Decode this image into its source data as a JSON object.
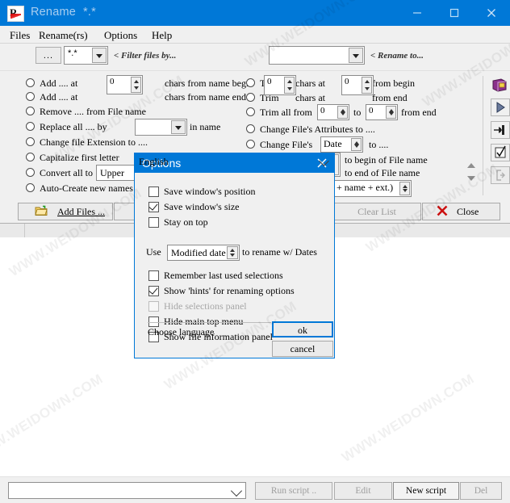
{
  "window": {
    "title": "Rename",
    "title_pattern": "*.*",
    "controls": {
      "minimize": "minimize-icon",
      "maximize": "maximize-icon",
      "close": "close-icon"
    },
    "accent_color": "#0078d7",
    "titlebar_text_color": "#a9cef0",
    "background": "#f0f0f0"
  },
  "menu": {
    "items": [
      "Files",
      "Rename(rs)",
      "Options",
      "Help"
    ]
  },
  "toolbar": {
    "browse_label": "...",
    "filter_value": "*.*",
    "filter_hint": "< Filter files by...",
    "renameto_value": "",
    "renameto_hint": "< Rename to..."
  },
  "left_options": [
    {
      "label": "Add ....  at",
      "spin": "0",
      "suffix": "chars from name begin"
    },
    {
      "label": "Add ....  at",
      "spin": "",
      "suffix": "chars from name end"
    },
    {
      "label": "Remove ....  from File name",
      "spin": null,
      "suffix": ""
    },
    {
      "label": "Replace all .... by",
      "textbox": "",
      "suffix": "in name"
    },
    {
      "label": "Change file Extension to ....",
      "suffix": ""
    },
    {
      "label": "Capitalize first letter",
      "checkbox": true,
      "suffix": ""
    },
    {
      "label": "Convert all to",
      "combo": "Upper",
      "suffix": ""
    },
    {
      "label": "Auto-Create new names",
      "suffix": ""
    }
  ],
  "right_options": [
    {
      "label": "Trim",
      "spin1": "0",
      "mid": "chars at",
      "spin2": "0",
      "suffix": "from begin"
    },
    {
      "label": "Trim",
      "spin1": "",
      "mid": "chars at",
      "spin2": "",
      "suffix": "from  end"
    },
    {
      "label": "Trim all from",
      "spin1": "0",
      "mid": "to",
      "spin2": "0",
      "suffix": "from end"
    },
    {
      "label": "Change File's Attributes to  ....",
      "suffix": ""
    },
    {
      "label": "Change File's",
      "combo": "Date",
      "suffix": "to  ...."
    },
    {
      "label": "",
      "suffix": "to begin of File name"
    },
    {
      "label": "",
      "suffix": "to end of File name"
    },
    {
      "label": "",
      "combo2": "(# + name + ext.)",
      "suffix": ""
    }
  ],
  "tool_strip": [
    {
      "name": "book-icon"
    },
    {
      "name": "play-icon"
    },
    {
      "name": "pin-icon"
    },
    {
      "name": "checklist-icon"
    },
    {
      "name": "exit-icon"
    }
  ],
  "command_bar": {
    "add_files": "Add Files ...",
    "add_files_accesskey": "A",
    "clear_list": "Clear List",
    "clear_list_accesskey": "L",
    "close": "Close",
    "close_accesskey": "C"
  },
  "bottom_bar": {
    "script_value": "",
    "run_script": "Run script ..",
    "edit": "Edit",
    "new_script": "New script",
    "del": "Del"
  },
  "dialog": {
    "title": "Options",
    "close_icon": "close-icon",
    "checkboxes": [
      {
        "label": "Save window's position",
        "checked": false,
        "disabled": false
      },
      {
        "label": "Save window's size",
        "checked": true,
        "disabled": false
      },
      {
        "label": "Stay on top",
        "checked": false,
        "disabled": false
      }
    ],
    "date_row": {
      "prefix": "Use",
      "value": "Modified date",
      "suffix": "to rename w/ Dates"
    },
    "checkboxes2": [
      {
        "label": "Remember last used selections",
        "checked": false,
        "disabled": false
      },
      {
        "label": "Show 'hints' for renaming options",
        "checked": true,
        "disabled": false
      },
      {
        "label": "Hide selections panel",
        "checked": false,
        "disabled": true
      },
      {
        "label": "Hide main top menu",
        "checked": false,
        "disabled": false
      },
      {
        "label": "Show file information panel",
        "checked": false,
        "disabled": false
      }
    ],
    "language_label": "Choose language",
    "language_value": "English",
    "ok": "ok",
    "cancel": "cancel"
  },
  "watermark": {
    "text": "WWW.WEIDOWN.COM"
  }
}
